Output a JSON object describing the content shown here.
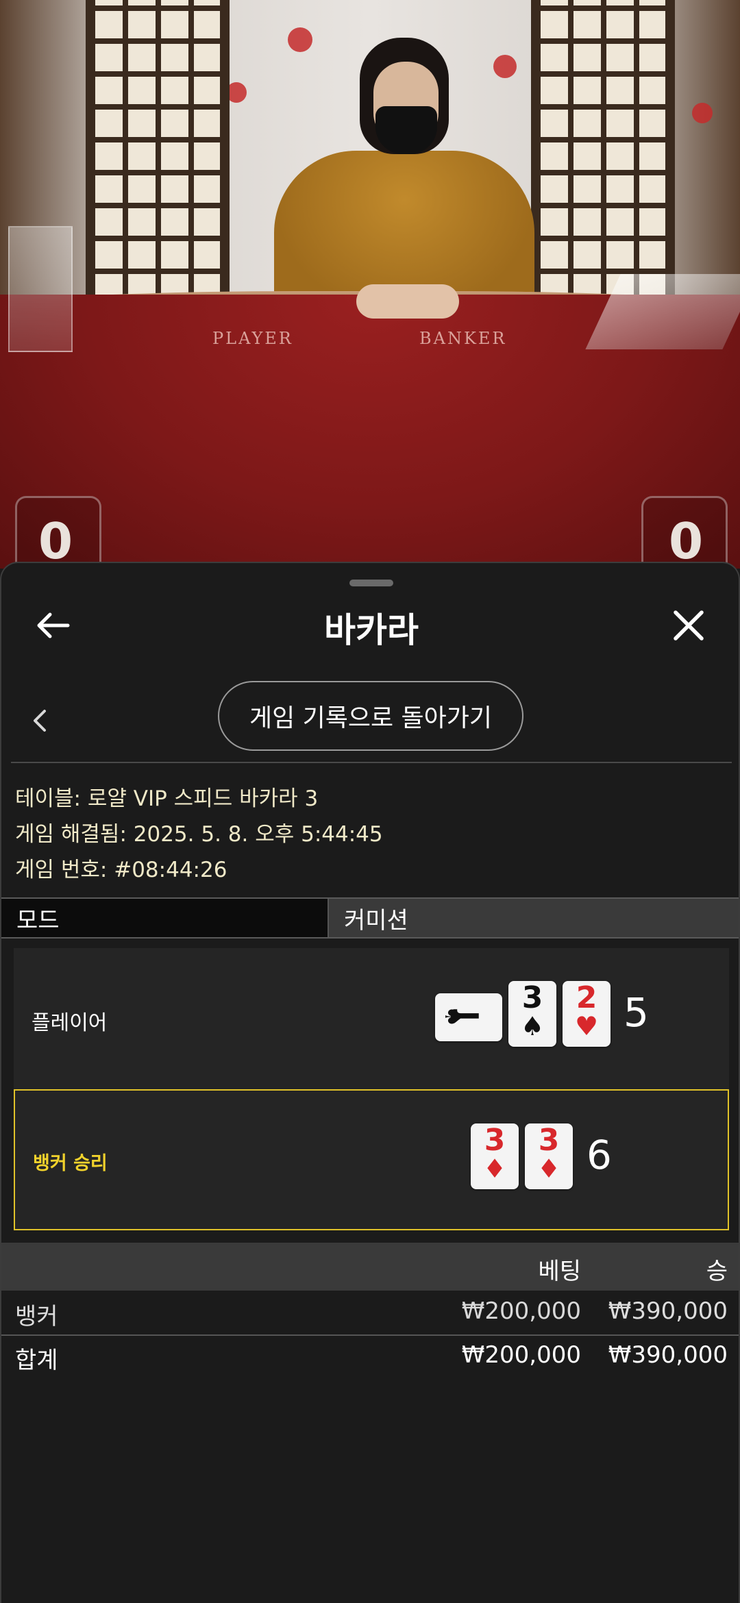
{
  "video": {
    "felt_labels": {
      "player": "PLAYER",
      "banker": "BANKER"
    },
    "player_score": "0",
    "banker_score": "0"
  },
  "header": {
    "title": "바카라",
    "back_icon": "arrow-left-icon",
    "close_icon": "close-icon"
  },
  "nav": {
    "chevron_icon": "chevron-left-icon",
    "history_button": "게임 기록으로 돌아가기"
  },
  "info": {
    "table": "테이블: 로얄 VIP 스피드 바카라 3",
    "resolved": "게임 해결됨: 2025. 5. 8. 오후 5:44:45",
    "game_number": "게임 번호: #08:44:26"
  },
  "tabs": [
    {
      "label": "모드",
      "selected": true
    },
    {
      "label": "커미션",
      "selected": false
    }
  ],
  "hands": {
    "player": {
      "label": "플레이어",
      "score": "5",
      "cards": [
        {
          "rank": "J",
          "suit": "♠",
          "color": "black",
          "rotated": true
        },
        {
          "rank": "3",
          "suit": "♠",
          "color": "black"
        },
        {
          "rank": "2",
          "suit": "♥",
          "color": "red"
        }
      ]
    },
    "banker": {
      "label": "뱅커 승리",
      "score": "6",
      "winner": true,
      "cards": [
        {
          "rank": "3",
          "suit": "♦",
          "color": "red"
        },
        {
          "rank": "3",
          "suit": "♦",
          "color": "red"
        }
      ]
    }
  },
  "bets": {
    "header_bet": "베팅",
    "header_win": "승",
    "rows": [
      {
        "label": "뱅커",
        "bet": "₩200,000",
        "win": "₩390,000"
      },
      {
        "label": "합계",
        "bet": "₩200,000",
        "win": "₩390,000"
      }
    ]
  },
  "colors": {
    "winner_accent": "#e0c229",
    "info_text": "#f0e9c8",
    "card_red": "#d8282c"
  }
}
